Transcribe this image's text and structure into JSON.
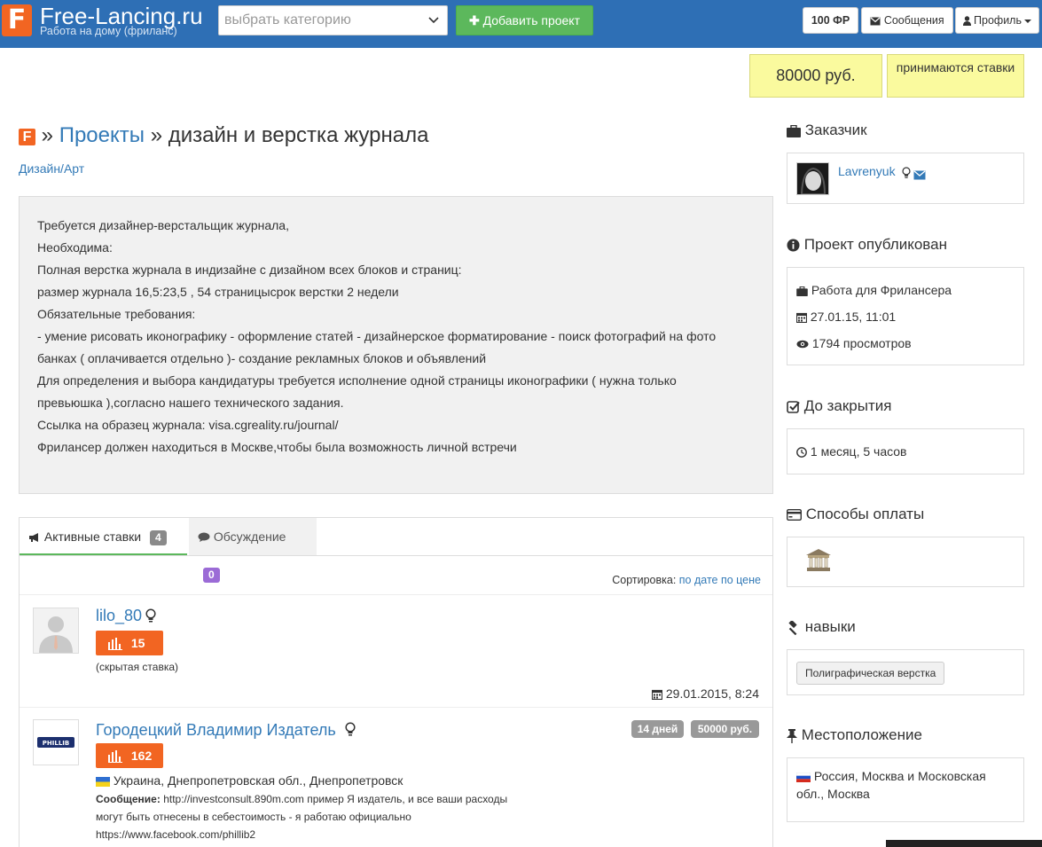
{
  "header": {
    "logo_letter": "F",
    "site_name": "Free-Lancing.ru",
    "site_tagline": "Работа на дому (фриланс)",
    "category_placeholder": "выбрать категорию",
    "add_project_label": "Добавить проект",
    "coins_label": "100 ФР",
    "messages_label": "Сообщения",
    "profile_label": "Профиль"
  },
  "price": {
    "amount": "80000 руб.",
    "bids_status": "принимаются ставки"
  },
  "breadcrumb": {
    "icon_letter": "F",
    "sep1": "»",
    "projects": "Проекты",
    "sep2": "»",
    "title": "дизайн и верстка журнала"
  },
  "category_link": "Дизайн/Арт",
  "description": [
    "Требуется дизайнер-верстальщик журнала,",
    "Необходима:",
    "Полная верстка журнала в индизайне с дизайном всех блоков и страниц:",
    "размер журнала 16,5:23,5 , 54 страницысрок верстки 2 недели",
    "Обязательные требования:",
    "- умение рисовать иконографику - оформление статей - дизайнерское форматирование - поиск фотографий на фото",
    "банках ( оплачивается отдельно )- создание рекламных блоков и объявлений",
    "Для определения и выбора кандидатуры требуется исполнение одной страницы иконографики ( нужна только",
    "превьюшка ),согласно нашего технического задания.",
    "Ссылка на образец журнала: visa.cgreality.ru/journal/",
    "Фрилансер должен находиться в Москве,чтобы была возможность личной встречи"
  ],
  "tabs": {
    "active_bids": {
      "label": "Активные ставки",
      "count": "4"
    },
    "discussion": {
      "label": "Обсуждение",
      "count": "0"
    }
  },
  "sort": {
    "label": "Сортировка:",
    "by_date": "по дате",
    "by_price": "по цене"
  },
  "bids": [
    {
      "name": "lilo_80",
      "rating": "15",
      "note": "(скрытая ставка)",
      "date": "29.01.2015, 8:24"
    },
    {
      "name": "Городецкий Владимир Издатель",
      "rating": "162",
      "avatar_text": "PHILLIB",
      "days": "14 дней",
      "price": "50000 руб.",
      "location": "Украина, Днепропетровская обл., Днепропетровск",
      "message_label": "Сообщение:",
      "message_line1": "http://investconsult.890m.com пример Я издатель, и все ваши расходы",
      "message_line2": "могут быть отнесены в себестоимость - я работаю официально",
      "message_line3": "https://www.facebook.com/phillib2"
    }
  ],
  "sidebar": {
    "customer_title": "Заказчик",
    "customer_name": "Lavrenyuk",
    "published_title": "Проект опубликован",
    "published_type": "Работа для Фрилансера",
    "published_date": "27.01.15, 11:01",
    "views": "1794 просмотров",
    "closing_title": "До закрытия",
    "closing_value": "1 месяц, 5 часов",
    "payment_title": "Способы оплаты",
    "skills_title": "навыки",
    "skill": "Полиграфическая верстка",
    "location_title": "Местоположение",
    "location_line1": "Россия, Москва и Московская",
    "location_line2": "обл., Москва"
  },
  "colors": {
    "topbar": "#2e6fb5",
    "brand_orange": "#f26522",
    "add_green": "#5cb85c",
    "price_yellow": "#fafa9e",
    "link_blue": "#337ab7"
  }
}
